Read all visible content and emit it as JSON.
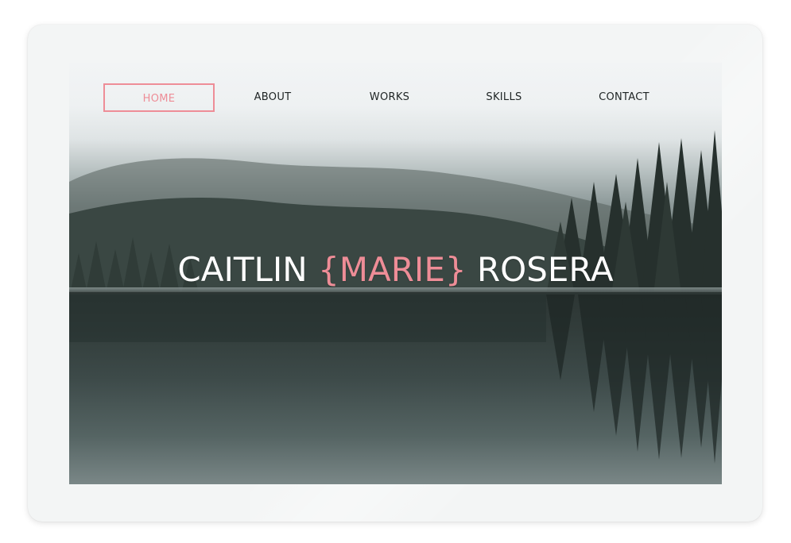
{
  "nav": {
    "items": [
      {
        "label": "HOME",
        "active": true
      },
      {
        "label": "ABOUT",
        "active": false
      },
      {
        "label": "WORKS",
        "active": false
      },
      {
        "label": "SKILLS",
        "active": false
      },
      {
        "label": "CONTACT",
        "active": false
      }
    ]
  },
  "hero": {
    "first": "CAITLIN",
    "middle": "{MARIE}",
    "last": "ROSERA"
  },
  "colors": {
    "accent": "#ee8d97",
    "nav_text": "#1e2424",
    "hero_text": "#ffffff",
    "frame_bg": "#f3f5f5"
  }
}
